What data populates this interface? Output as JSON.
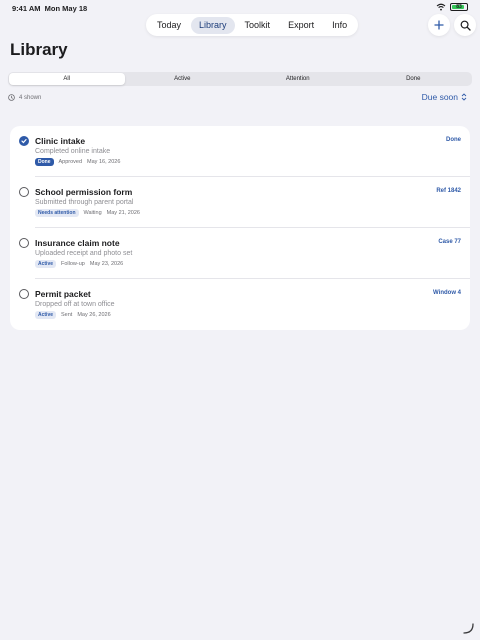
{
  "status": {
    "time": "9:41 AM",
    "date": "Mon May 18",
    "battery": "83"
  },
  "nav": {
    "tabs": [
      "Today",
      "Library",
      "Toolkit",
      "Export",
      "Info"
    ],
    "active": "Library"
  },
  "page": {
    "title": "Library"
  },
  "filters": {
    "options": [
      "All",
      "Active",
      "Attention",
      "Done"
    ],
    "active": "All"
  },
  "count_label": "4 shown",
  "sort": {
    "label": "Due soon"
  },
  "items": [
    {
      "title": "Clinic intake",
      "subtitle": "Completed online intake",
      "badge": "Done",
      "status": "Approved",
      "date": "May 16, 2026",
      "ref": "Done",
      "checked": true
    },
    {
      "title": "School permission form",
      "subtitle": "Submitted through parent portal",
      "badge": "Needs attention",
      "status": "Waiting",
      "date": "May 21, 2026",
      "ref": "Ref 1842",
      "checked": false
    },
    {
      "title": "Insurance claim note",
      "subtitle": "Uploaded receipt and photo set",
      "badge": "Active",
      "status": "Follow-up",
      "date": "May 23, 2026",
      "ref": "Case 77",
      "checked": false
    },
    {
      "title": "Permit packet",
      "subtitle": "Dropped off at town office",
      "badge": "Active",
      "status": "Sent",
      "date": "May 26, 2026",
      "ref": "Window 4",
      "checked": false
    }
  ],
  "colors": {
    "accent": "#2f5aa8",
    "background": "#f2f2f7",
    "card": "#ffffff",
    "battery": "#34c759"
  },
  "icons": [
    "wifi-icon",
    "battery-icon",
    "plus-icon",
    "search-icon",
    "clock-icon",
    "sort-chevron-icon",
    "checkmark-icon",
    "resize-handle-icon"
  ]
}
